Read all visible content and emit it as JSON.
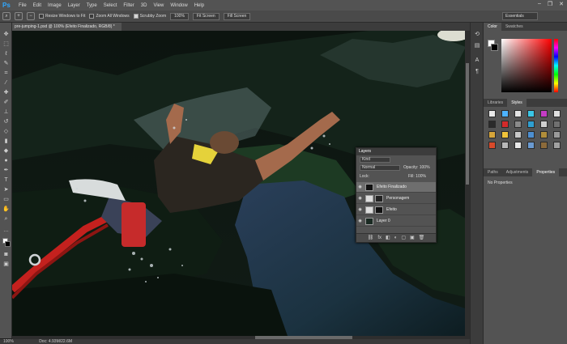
{
  "app": {
    "logo": "Ps"
  },
  "menu": [
    "File",
    "Edit",
    "Image",
    "Layer",
    "Type",
    "Select",
    "Filter",
    "3D",
    "View",
    "Window",
    "Help"
  ],
  "window_controls": [
    "–",
    "❐",
    "✕"
  ],
  "options_bar": {
    "resize_windows_label": "Resize Windows to Fit",
    "zoom_all_label": "Zoom All Windows",
    "scrubby_zoom_label": "Scrubby Zoom",
    "zoom_value": "100%",
    "fit_screen_label": "Fit Screen",
    "fill_screen_label": "Fill Screen",
    "workspace": "Essentials"
  },
  "document": {
    "tab_title": "pre-jumping-1.psd @ 100% (Efeito Finalizado, RGB/8) *",
    "status_zoom": "100%",
    "status_doc": "Doc: 4.93M/22.6M"
  },
  "color_panel": {
    "tab_color": "Color",
    "tab_swatches": "Swatches"
  },
  "libraries_panel": {
    "tab_libraries": "Libraries",
    "tab_styles": "Styles"
  },
  "style_swatch_colors": [
    "#e8e8e8",
    "#4db3ff",
    "#e3e3e3",
    "#3bc6e6",
    "#c43cc4",
    "#e0e0e0",
    "#2a2a2a",
    "#d32a2a",
    "#8a8a8a",
    "#2f9fd1",
    "#cfcfcf",
    "#707070",
    "#d6a53a",
    "#f0c33a",
    "#c8c8c8",
    "#4d8fd1",
    "#b08d3a",
    "#9a9a9a",
    "#d84a2a",
    "#b8b8b8",
    "#e8e8e8",
    "#6a9ad1",
    "#8c6a3a",
    "#a0a0a0"
  ],
  "properties_panel": {
    "tab_paths": "Paths",
    "tab_adjustments": "Adjustments",
    "tab_properties": "Properties",
    "body": "No Properties"
  },
  "layers_panel": {
    "title": "Layers",
    "filter_kind": "Kind",
    "blend_mode": "Normal",
    "opacity_label": "Opacity:",
    "opacity_value": "100%",
    "lock_label": "Lock:",
    "fill_label": "Fill:",
    "fill_value": "100%",
    "layers": [
      {
        "name": "Efeito Finalizado",
        "selected": true
      },
      {
        "name": "Personagem",
        "selected": false
      },
      {
        "name": "Efeito",
        "selected": false
      },
      {
        "name": "Layer 0",
        "selected": false
      }
    ],
    "footer_icons": [
      "⛓",
      "fx",
      "◧",
      "◐",
      "▢",
      "▣",
      "🗑"
    ]
  }
}
